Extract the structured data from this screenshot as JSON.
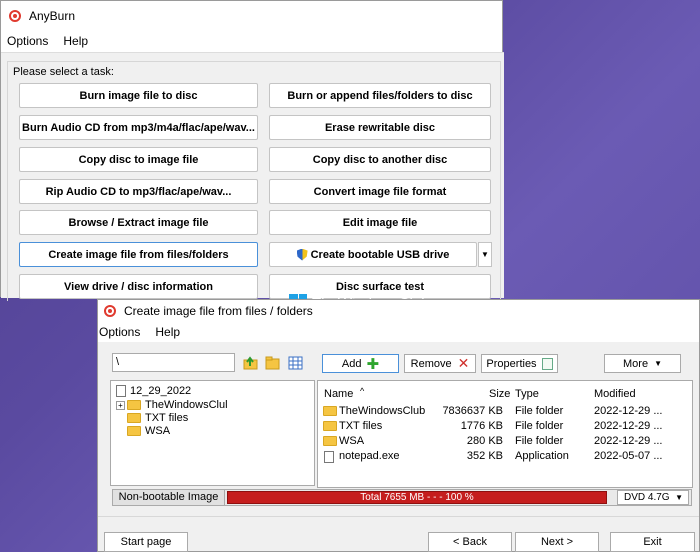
{
  "anyburn": {
    "title": "AnyBurn",
    "menu": [
      "Options",
      "Help"
    ],
    "prompt": "Please select a task:",
    "tasks": [
      "Burn image file to disc",
      "Burn or append files/folders to disc",
      "Burn Audio CD from mp3/m4a/flac/ape/wav...",
      "Erase rewritable disc",
      "Copy disc to image file",
      "Copy disc to another disc",
      "Rip Audio CD to mp3/flac/ape/wav...",
      "Convert image file format",
      "Browse / Extract image file",
      "Edit image file",
      "Create image file from files/folders",
      "Create bootable USB drive",
      "View drive / disc information",
      "Disc surface test"
    ],
    "selected_task": "Create image file from files/folders"
  },
  "watermark": "TheWindowsClub",
  "create_dialog": {
    "title": "Create image file from files / folders",
    "menu": [
      "Options",
      "Help"
    ],
    "path": "\\",
    "toolbar": {
      "add": "Add",
      "remove": "Remove",
      "properties": "Properties",
      "more": "More"
    },
    "tree": {
      "root": "12_29_2022",
      "children": [
        "TheWindowsClul",
        "TXT files",
        "WSA"
      ]
    },
    "list": {
      "columns": [
        "Name",
        "Size",
        "Type",
        "Modified"
      ],
      "rows": [
        {
          "name": "TheWindowsClub",
          "size": "7836637 KB",
          "type": "File folder",
          "modified": "2022-12-29 ...",
          "icon": "folder-icon"
        },
        {
          "name": "TXT files",
          "size": "1776 KB",
          "type": "File folder",
          "modified": "2022-12-29 ...",
          "icon": "folder-icon"
        },
        {
          "name": "WSA",
          "size": "280 KB",
          "type": "File folder",
          "modified": "2022-12-29 ...",
          "icon": "folder-icon"
        },
        {
          "name": "notepad.exe",
          "size": "352 KB",
          "type": "Application",
          "modified": "2022-05-07 ...",
          "icon": "file-icon"
        }
      ]
    },
    "status": {
      "image_type": "Non-bootable Image",
      "total": "Total  7655 MB   - - -  100 %",
      "fill_percent": 100,
      "fill_color": "#c51d1d",
      "media": "DVD 4.7G"
    },
    "bottom_buttons": {
      "start": "Start page",
      "back": "< Back",
      "next": "Next >",
      "exit": "Exit"
    }
  }
}
